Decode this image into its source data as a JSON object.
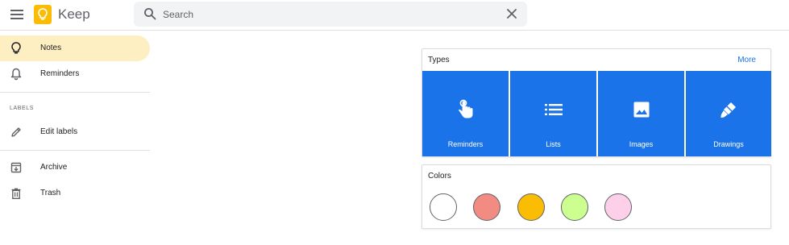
{
  "header": {
    "app_title": "Keep",
    "search": {
      "placeholder": "Search",
      "value": ""
    }
  },
  "sidebar": {
    "items": [
      {
        "label": "Notes",
        "icon": "lightbulb-icon",
        "active": true
      },
      {
        "label": "Reminders",
        "icon": "bell-icon",
        "active": false
      }
    ],
    "labels_section_title": "LABELS",
    "edit_labels": {
      "label": "Edit labels",
      "icon": "pencil-icon"
    },
    "bottom_items": [
      {
        "label": "Archive",
        "icon": "archive-icon"
      },
      {
        "label": "Trash",
        "icon": "trash-icon"
      }
    ]
  },
  "types_card": {
    "title": "Types",
    "more_label": "More",
    "tiles": [
      {
        "label": "Reminders",
        "icon": "touch-hand-icon"
      },
      {
        "label": "Lists",
        "icon": "list-icon"
      },
      {
        "label": "Images",
        "icon": "image-icon"
      },
      {
        "label": "Drawings",
        "icon": "brush-icon"
      }
    ],
    "tile_color": "#1a73e8"
  },
  "colors_card": {
    "title": "Colors",
    "swatches": [
      {
        "name": "white",
        "color": "#ffffff"
      },
      {
        "name": "red",
        "color": "#f28b82"
      },
      {
        "name": "orange",
        "color": "#fbbc04"
      },
      {
        "name": "green",
        "color": "#ccff90"
      },
      {
        "name": "pink",
        "color": "#fdcfe8"
      }
    ]
  },
  "colors": {
    "accent": "#1a73e8",
    "active_nav": "#feefc3",
    "logo": "#fbbc04"
  }
}
